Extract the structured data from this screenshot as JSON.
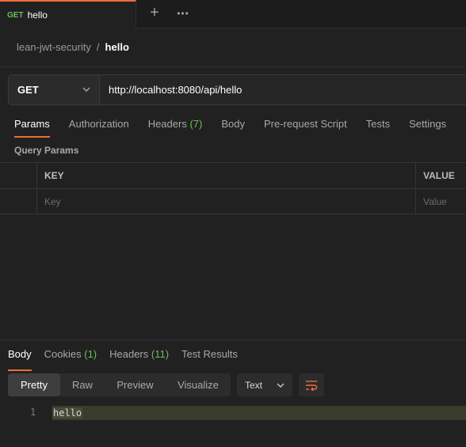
{
  "tab": {
    "method": "GET",
    "title": "hello"
  },
  "toolbar": {
    "add_icon": "plus-icon",
    "more_icon": "more-icon"
  },
  "breadcrumb": {
    "parent": "lean-jwt-security",
    "separator": "/",
    "current": "hello"
  },
  "request": {
    "method": "GET",
    "url": "http://localhost:8080/api/hello"
  },
  "request_tabs": {
    "params": "Params",
    "authorization": "Authorization",
    "headers": "Headers",
    "headers_count": "(7)",
    "body": "Body",
    "prerequest": "Pre-request Script",
    "tests": "Tests",
    "settings": "Settings"
  },
  "query_params": {
    "title": "Query Params",
    "col_key": "KEY",
    "col_value": "VALUE",
    "key_placeholder": "Key",
    "value_placeholder": "Value"
  },
  "response_tabs": {
    "body": "Body",
    "cookies": "Cookies",
    "cookies_count": "(1)",
    "headers": "Headers",
    "headers_count": "(11)",
    "test_results": "Test Results"
  },
  "view_modes": {
    "pretty": "Pretty",
    "raw": "Raw",
    "preview": "Preview",
    "visualize": "Visualize"
  },
  "format": {
    "selected": "Text"
  },
  "response_body": {
    "line_number": "1",
    "text": "hello"
  },
  "colors": {
    "accent": "#f26b3a",
    "get_method": "#6bbf59",
    "count_badge": "#6bbf59"
  }
}
